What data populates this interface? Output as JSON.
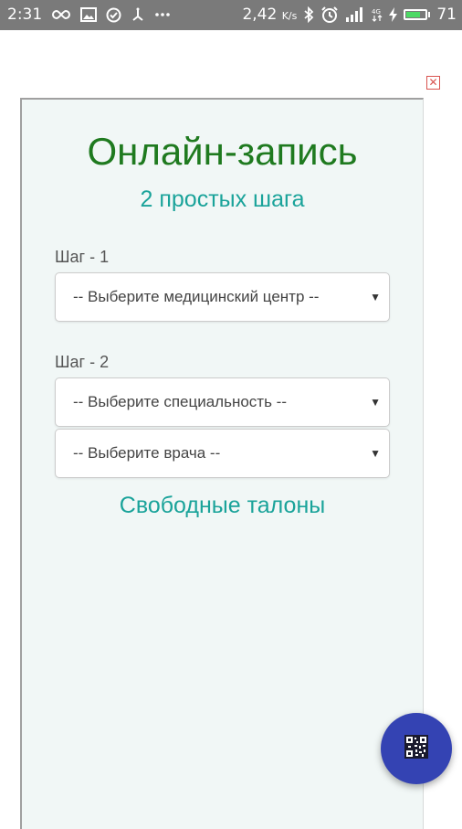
{
  "status_bar": {
    "time": "2:31",
    "speed": "2,42",
    "speed_unit": "K/s",
    "battery": "71",
    "battery_level": 0.71,
    "icons": [
      "infinity-icon",
      "image-icon",
      "check-circle-icon",
      "usb-icon",
      "more-icon",
      "bluetooth-icon",
      "alarm-icon",
      "signal-icon",
      "4g-icon",
      "charging-icon",
      "battery-icon"
    ]
  },
  "ad": {
    "close_symbol": "✕"
  },
  "form": {
    "title": "Онлайн-запись",
    "subtitle": "2 простых шага",
    "step1_label": "Шаг - 1",
    "clinic_select": "-- Выберите медицинский центр --",
    "step2_label": "Шаг - 2",
    "specialty_select": "-- Выберите специальность --",
    "doctor_select": "-- Выберите врача --",
    "free_slots_link": "Свободные талоны"
  },
  "fab": {
    "icon": "qr-code-icon"
  },
  "colors": {
    "title": "#1f7a1f",
    "accent": "#1aa39a",
    "fab": "#3443b3",
    "panel_bg": "#f1f7f6"
  }
}
